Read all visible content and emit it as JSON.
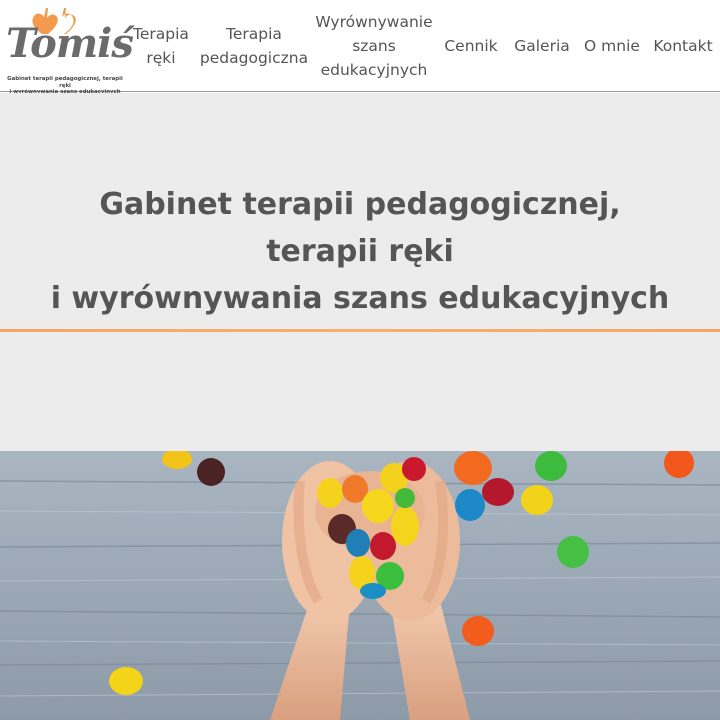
{
  "logo": {
    "word": "Tomiś",
    "tagline_1": "Gabinet terapii pedagogicznej, terapii ręki",
    "tagline_2": "i wyrównywania szans edukacyjnych",
    "heart_color": "#f39a4e"
  },
  "nav": {
    "items": [
      {
        "label": "Terapia\nręki"
      },
      {
        "label": "Terapia\npedagogiczna"
      },
      {
        "label": "Wyrównywanie\nszans\nedukacyjnych"
      },
      {
        "label": "Cennik"
      },
      {
        "label": "Galeria"
      },
      {
        "label": "O mnie"
      },
      {
        "label": "Kontakt"
      }
    ]
  },
  "hero": {
    "line_1": "Gabinet terapii pedagogicznej,",
    "line_2": "terapii ręki",
    "line_3": "i wyrównywania szans edukacyjnych",
    "accent_color": "#f3a763"
  },
  "photo": {
    "subject": "child hands holding colorful candies on wooden table"
  }
}
